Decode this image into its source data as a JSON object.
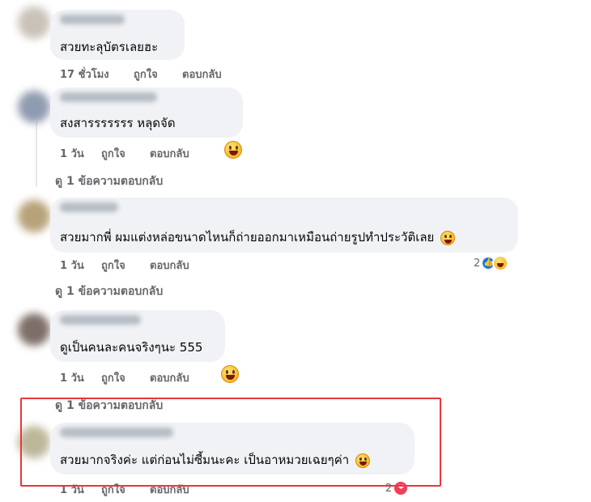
{
  "comments": [
    {
      "text": "สวยทะลุบัตรเลยฮะ",
      "time": "17 ชั่วโมง",
      "like_label": "ถูกใจ",
      "reply_label": "ตอบกลับ"
    },
    {
      "text": "สงสารรรรรรร หลุดจัด",
      "time": "1 วัน",
      "like_label": "ถูกใจ",
      "reply_label": "ตอบกลับ",
      "reaction_emoji": "grinning-emoji",
      "view_replies": "ดู 1 ข้อความตอบกลับ"
    },
    {
      "text": "สวยมากพี่ ผมแต่งหล่อขนาดไหนก็ถ่ายออกมาเหมือนถ่ายรูปทำประวัติเลย",
      "inline_emoji": "crying-emoji",
      "time": "1 วัน",
      "like_label": "ถูกใจ",
      "reply_label": "ตอบกลับ",
      "reaction_count": "2",
      "reactions": [
        "like-icon",
        "haha-icon"
      ],
      "view_replies": "ดู 1 ข้อความตอบกลับ"
    },
    {
      "text": "ดูเป็นคนละคนจริงๆนะ 555",
      "time": "1 วัน",
      "like_label": "ถูกใจ",
      "reply_label": "ตอบกลับ",
      "reaction_emoji": "grinning-emoji",
      "view_replies": "ดู 1 ข้อความตอบกลับ"
    },
    {
      "text": "สวยมากจริงค่ะ แต่ก่อนไม่ซี้มนะคะ เป็นอาหมวยเฉยๆค่า",
      "inline_emoji": "laughing-emoji",
      "time": "1 วัน",
      "like_label": "ถูกใจ",
      "reply_label": "ตอบกลับ",
      "reaction_count": "2",
      "reactions": [
        "heart-icon"
      ]
    }
  ],
  "colors": {
    "bubble": "#f0f2f5",
    "meta_text": "#65676b",
    "like_blue": "#1877f2",
    "love_red": "#f33e58",
    "highlight_border": "#e8363f"
  }
}
